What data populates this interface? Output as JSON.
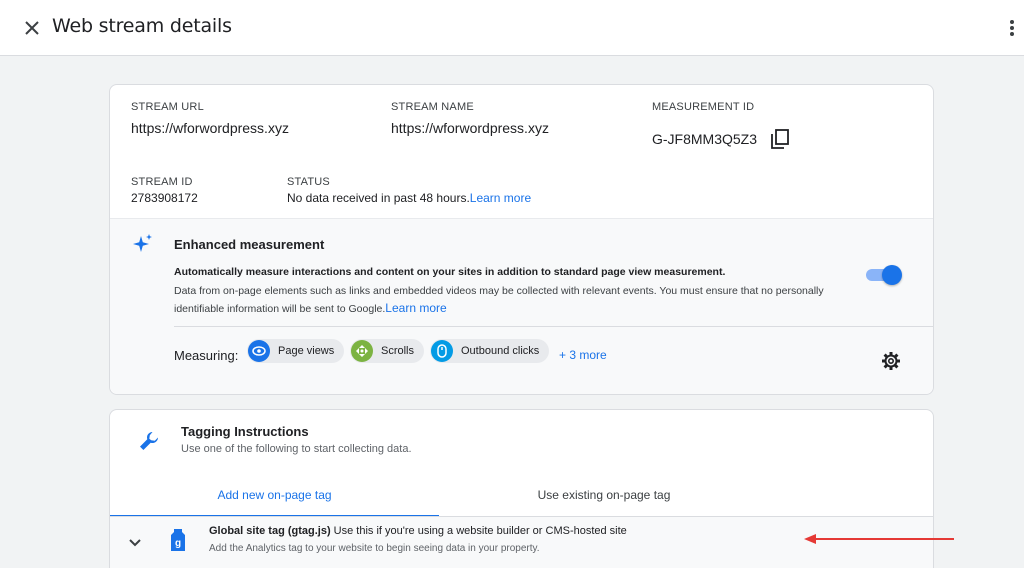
{
  "header": {
    "title": "Web stream details",
    "close_icon": "close-icon",
    "more_icon": "more-vert-icon"
  },
  "stream": {
    "url_label": "STREAM URL",
    "url_value": "https://wforwordpress.xyz",
    "name_label": "STREAM NAME",
    "name_value": "https://wforwordpress.xyz",
    "mid_label": "MEASUREMENT ID",
    "mid_value": "G-JF8MM3Q5Z3",
    "id_label": "STREAM ID",
    "id_value": "2783908172",
    "status_label": "STATUS",
    "status_value": "No data received in past 48 hours.",
    "status_link": "Learn more"
  },
  "enhanced": {
    "title": "Enhanced measurement",
    "desc1": "Automatically measure interactions and content on your sites in addition to standard page view measurement.",
    "desc2": "Data from on-page elements such as links and embedded videos may be collected with relevant events. You must ensure that no personally identifiable information will be sent to Google.",
    "learn_more": "Learn more",
    "enabled": true,
    "measuring_label": "Measuring:",
    "chips": [
      {
        "label": "Page views",
        "icon": "eye-icon",
        "color": "#1a73e8"
      },
      {
        "label": "Scrolls",
        "icon": "scroll-icon",
        "color": "#7cb342"
      },
      {
        "label": "Outbound clicks",
        "icon": "mouse-icon",
        "color": "#039be5"
      }
    ],
    "more_link": "+ 3 more"
  },
  "tagging": {
    "title": "Tagging Instructions",
    "subtitle": "Use one of the following to start collecting data.",
    "tabs": [
      "Add new on-page tag",
      "Use existing on-page tag"
    ],
    "active_tab": 0,
    "row_title_bold": "Global site tag (gtag.js)",
    "row_title_rest": " Use this if you're using a website builder or CMS-hosted site",
    "row_subtitle": "Add the Analytics tag to your website to begin seeing data in your property."
  },
  "colors": {
    "accent": "#1a73e8",
    "annotation_arrow": "#e53935"
  }
}
